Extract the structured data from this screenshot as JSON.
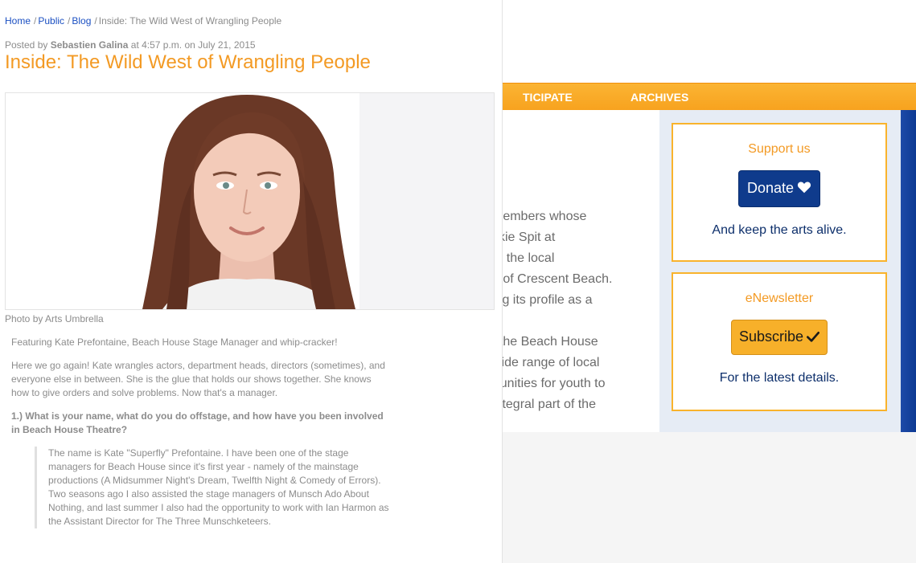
{
  "nav": {
    "items": [
      "TICIPATE",
      "ARCHIVES"
    ]
  },
  "background_text": {
    "lines_a": [
      "members whose",
      "ckie Spit at",
      "th the local",
      "n of Crescent Beach.",
      "ing its profile as a"
    ],
    "lines_b": [
      ", the Beach House",
      "wide range of local",
      "rtunities for youth to",
      "integral part of the"
    ]
  },
  "sidebar": {
    "support": {
      "title": "Support us",
      "button": "Donate",
      "button_icon": "heart-icon",
      "note": "And keep the arts alive."
    },
    "newsletter": {
      "title": "eNewsletter",
      "button": "Subscribe",
      "button_icon": "checkmark-icon",
      "note": "For the latest details."
    }
  },
  "breadcrumb": {
    "home": "Home",
    "public": "Public",
    "blog": "Blog",
    "current": "Inside: The Wild West of Wrangling People",
    "separator": "/"
  },
  "post": {
    "posted_prefix": "Posted by",
    "author": "Sebastien Galina",
    "posted_suffix": "at 4:57 p.m. on July 21, 2015",
    "title": "Inside: The Wild West of Wrangling People",
    "photo_caption": "Photo by Arts Umbrella",
    "intro": "Featuring Kate Prefontaine, Beach House Stage Manager and whip-cracker!",
    "paragraph": "Here we go again! Kate wrangles actors, department heads, directors (sometimes), and everyone else in between. She is the glue that holds our shows together. She knows how to give orders and solve problems. Now that's a manager.",
    "question": "1.) What is your name, what do you do offstage, and how have you been involved in Beach House Theatre?",
    "answer": "The name is Kate \"Superfly\" Prefontaine. I have been one of the stage managers for Beach House since it's first year - namely of the mainstage productions (A Midsummer Night's Dream, Twelfth Night & Comedy of Errors). Two seasons ago I also assisted the stage managers of Munsch Ado About Nothing, and last summer I also had the opportunity to work with Ian Harmon as the Assistant Director for The Three Munschketeers."
  },
  "colors": {
    "accent_orange": "#f39a24",
    "nav_orange": "#f7a21e",
    "donate_blue": "#0f3b8c",
    "link_blue": "#1a4fc2",
    "subscribe_yellow": "#f7b02a"
  }
}
